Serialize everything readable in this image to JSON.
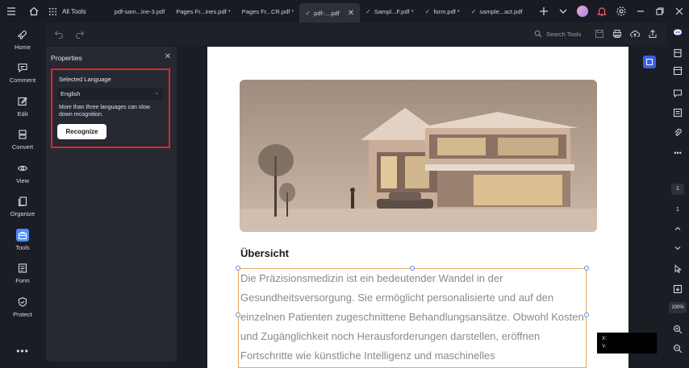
{
  "titlebar": {
    "all_tools": "All Tools",
    "tabs": [
      {
        "label": "pdf-sam...ine-3.pdf"
      },
      {
        "label": "Pages Fr...ines.pdf *"
      },
      {
        "label": "Pages Fr...CR.pdf *"
      },
      {
        "label": "pdf-....pdf",
        "active": true
      },
      {
        "label": "Sampl...F.pdf *"
      },
      {
        "label": "form.pdf *"
      },
      {
        "label": "sample...act.pdf"
      }
    ]
  },
  "leftnav": {
    "items": [
      {
        "label": "Home",
        "icon": "rocket-icon"
      },
      {
        "label": "Comment",
        "icon": "comment-icon"
      },
      {
        "label": "Edit",
        "icon": "edit-icon"
      },
      {
        "label": "Convert",
        "icon": "convert-icon"
      },
      {
        "label": "View",
        "icon": "eye-icon"
      },
      {
        "label": "Organize",
        "icon": "organize-icon"
      },
      {
        "label": "Tools",
        "icon": "toolbox-icon",
        "active": true
      },
      {
        "label": "Form",
        "icon": "form-icon"
      },
      {
        "label": "Protect",
        "icon": "shield-icon"
      }
    ],
    "more": "•••"
  },
  "toolbar": {
    "search_label": "Search Tools"
  },
  "properties": {
    "title": "Properties",
    "selected_language_label": "Selected Language",
    "language_value": "English",
    "hint": "More than three languages can slow down recognition.",
    "recognize_label": "Recognize"
  },
  "document": {
    "heading": "Übersicht",
    "body": "Die Präzisionsmedizin ist ein bedeutender Wandel in der Gesundheitsversorgung. Sie ermöglicht personalisierte und auf den einzelnen Patienten zugeschnittene Behandlungsansätze. Obwohl Kosten und Zugänglichkeit noch Herausforderungen darstellen, eröffnen Fortschritte wie künstliche Intelligenz und maschinelles"
  },
  "coords": {
    "x_label": "X:",
    "y_label": "Y:"
  },
  "rightrail": {
    "page_current": "1",
    "page_total": "1",
    "zoom": "100%"
  },
  "colors": {
    "accent": "#4a8cff",
    "highlight": "#e0242c",
    "selection": "#e8a95a"
  }
}
